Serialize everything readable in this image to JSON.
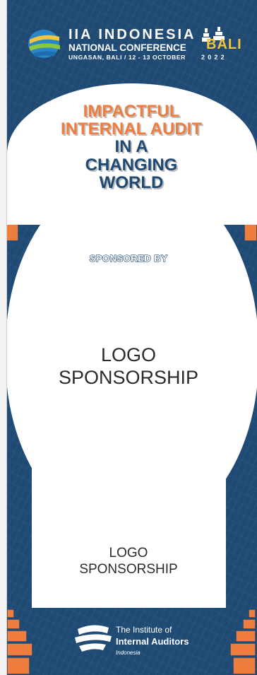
{
  "header": {
    "title": "IIA INDONESIA",
    "subtitle": "NATIONAL CONFERENCE",
    "location_date": "UNGASAN, BALI / 12 - 13 OCTOBER",
    "bali_word": "BALI",
    "year": "2022"
  },
  "headline": {
    "lines": [
      "IMPACTFUL",
      "INTERNAL AUDIT",
      "IN A",
      "CHANGING",
      "WORLD"
    ]
  },
  "sponsored_label": "SPONSORED BY",
  "sponsor_slots": [
    {
      "line1": "LOGO",
      "line2": "SPONSORSHIP"
    },
    {
      "line1": "LOGO",
      "line2": "SPONSORSHIP"
    }
  ],
  "footer": {
    "line1": "The Institute of",
    "line2": "Internal Auditors",
    "line3": "Indonesia"
  },
  "colors": {
    "navy": "#1f4a74",
    "orange": "#ef7d3e",
    "gold": "#f2c43d",
    "white": "#ffffff"
  }
}
